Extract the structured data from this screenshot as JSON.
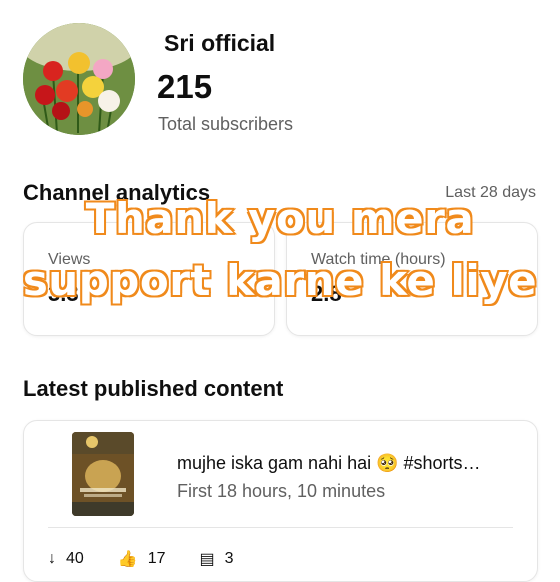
{
  "channel": {
    "name": "Sri official",
    "subscribers": "215",
    "subscribers_label": "Total subscribers"
  },
  "analytics": {
    "title": "Channel analytics",
    "range": "Last 28 days",
    "views_label": "Views",
    "views_value": "3.3",
    "watch_label": "Watch time (hours)",
    "watch_value": "2.8"
  },
  "latest": {
    "title": "Latest published content",
    "video_title": "mujhe iska gam nahi hai 🥺 #shorts…",
    "video_sub": "First 18 hours, 10 minutes",
    "views": "40",
    "likes": "17",
    "comments": "3"
  },
  "overlay": {
    "line1": "Thank you mera",
    "line2": "support karne ke liye"
  }
}
